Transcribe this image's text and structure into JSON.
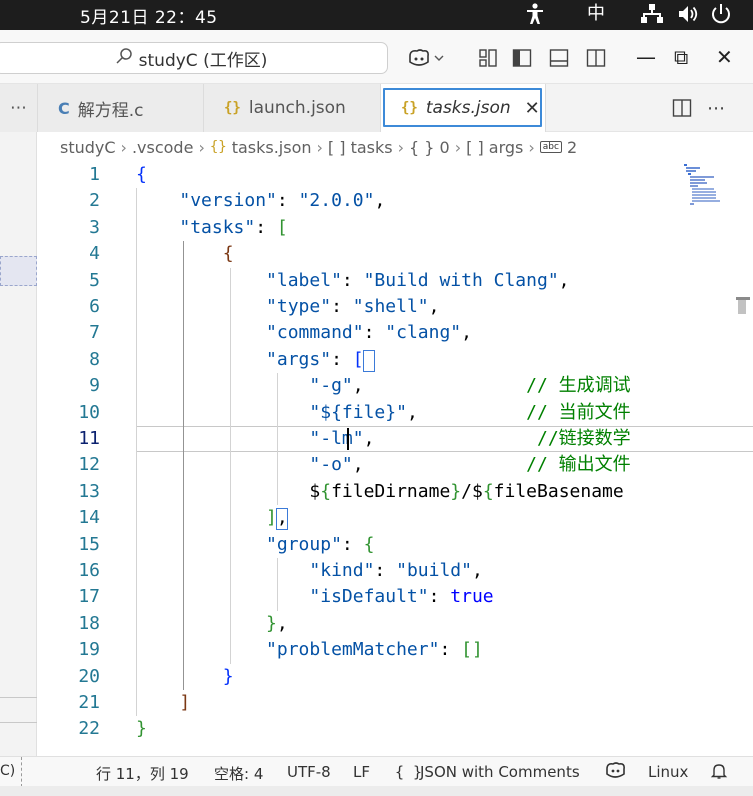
{
  "topbar": {
    "clock": "5月21日  22：45",
    "input_method": "中",
    "accessibility_icon": "accessibility-icon",
    "network_icon": "network-icon",
    "volume_icon": "volume-icon",
    "power_icon": "power-icon"
  },
  "titlebar": {
    "search_text": "studyC (工作区)",
    "copilot_icon": "copilot-icon",
    "layout_icons": [
      "customize-layout-icon",
      "toggle-primary-sidebar-icon",
      "toggle-panel-icon",
      "toggle-secondary-sidebar-icon"
    ],
    "minimize": "—",
    "restore": "⧉",
    "close": "✕"
  },
  "tabs": [
    {
      "icon": "C",
      "label": "解方程.c",
      "active": false
    },
    {
      "icon": "{}",
      "label": "launch.json",
      "active": false
    },
    {
      "icon": "{}",
      "label": "tasks.json",
      "active": true,
      "close": "✕"
    }
  ],
  "tab_actions": {
    "split": "split-editor-icon",
    "more": "⋯"
  },
  "left_overflow": "⋯",
  "breadcrumb": {
    "items": [
      "studyC",
      ".vscode",
      "tasks.json",
      "[ ] tasks",
      "{ } 0",
      "[ ] args",
      "2"
    ],
    "abc": "abc"
  },
  "editor": {
    "lines": [
      "{",
      "    \"version\": \"2.0.0\",",
      "    \"tasks\": [",
      "        {",
      "            \"label\": \"Build with Clang\",",
      "            \"type\": \"shell\",",
      "            \"command\": \"clang\",",
      "            \"args\": [",
      "                \"-g\",               // 生成调试",
      "                \"${file}\",          // 当前文件",
      "                \"-lm\",               //链接数学",
      "                \"-o\",               // 输出文件",
      "                \"${fileDirname}/${fileBasename",
      "            ],",
      "            \"group\": {",
      "                \"kind\": \"build\",",
      "                \"isDefault\": true",
      "            },",
      "            \"problemMatcher\": []",
      "        }",
      "    ]",
      "}"
    ],
    "line_numbers": [
      "1",
      "2",
      "3",
      "4",
      "5",
      "6",
      "7",
      "8",
      "9",
      "10",
      "11",
      "12",
      "13",
      "14",
      "15",
      "16",
      "17",
      "18",
      "19",
      "20",
      "21",
      "22"
    ],
    "current_line": 11
  },
  "statusbar": {
    "remote": "C)",
    "position": "行 11，列 19",
    "indent": "空格: 4",
    "encoding": "UTF-8",
    "eol": "LF",
    "language_icon": "{ }",
    "language": "JSON with Comments",
    "copilot_icon": "copilot-icon",
    "os": "Linux",
    "bell_icon": "bell-icon"
  }
}
